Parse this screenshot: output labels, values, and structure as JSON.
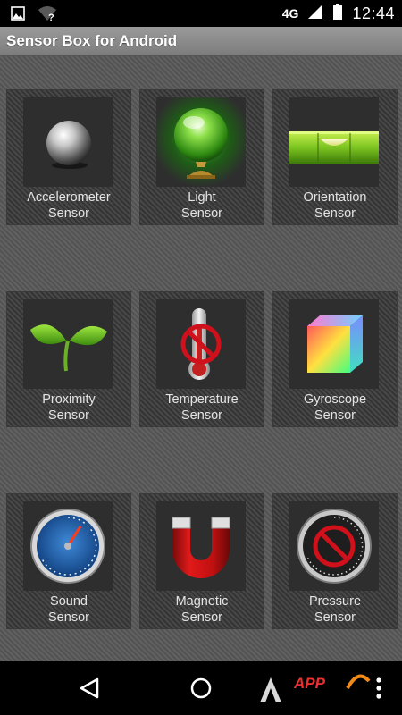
{
  "status_bar": {
    "network_type": "4G",
    "time": "12:44",
    "icons": [
      "image-notification-icon",
      "wifi-unknown-icon",
      "cell-signal-icon",
      "battery-icon"
    ]
  },
  "app": {
    "title": "Sensor Box for Android"
  },
  "sensors": [
    {
      "line1": "Accelerometer",
      "line2": "Sensor",
      "icon": "steel-ball-icon"
    },
    {
      "line1": "Light",
      "line2": "Sensor",
      "icon": "green-glass-orb-icon"
    },
    {
      "line1": "Orientation",
      "line2": "Sensor",
      "icon": "spirit-level-icon"
    },
    {
      "line1": "Proximity",
      "line2": "Sensor",
      "icon": "sprout-icon"
    },
    {
      "line1": "Temperature",
      "line2": "Sensor",
      "icon": "thermometer-unavailable-icon"
    },
    {
      "line1": "Gyroscope",
      "line2": "Sensor",
      "icon": "color-cube-icon"
    },
    {
      "line1": "Sound",
      "line2": "Sensor",
      "icon": "speedometer-gauge-icon"
    },
    {
      "line1": "Magnetic",
      "line2": "Sensor",
      "icon": "horseshoe-magnet-icon"
    },
    {
      "line1": "Pressure",
      "line2": "Sensor",
      "icon": "barometer-unavailable-icon"
    }
  ],
  "nav_bar": {
    "buttons": [
      "back-icon",
      "home-icon",
      "menu-icon"
    ],
    "watermark": "APP"
  },
  "colors": {
    "status_bar": "#000000",
    "title_bar": "#8a8a8a",
    "background": "#5c5c5c",
    "tile": "#424242",
    "unavailable_red": "#d0101a"
  }
}
